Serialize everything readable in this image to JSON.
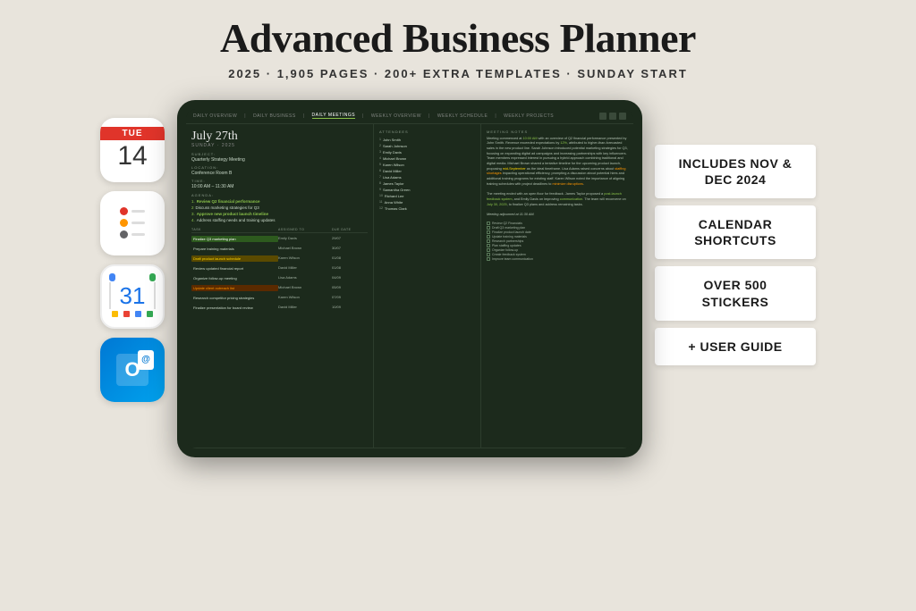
{
  "header": {
    "title": "Advanced Business Planner",
    "subtitle": "2025  ·  1,905 PAGES  ·  200+ EXTRA TEMPLATES  ·  SUNDAY START"
  },
  "badges": [
    {
      "id": "badge-nov-dec",
      "text": "INCLUDES NOV & DEC 2024"
    },
    {
      "id": "badge-calendar",
      "text": "CALENDAR SHORTCUTS"
    },
    {
      "id": "badge-stickers",
      "text": "OVER 500 STICKERS"
    },
    {
      "id": "badge-guide",
      "text": "+ USER GUIDE"
    }
  ],
  "planner": {
    "nav_items": [
      "DAILY OVERVIEW",
      "DAILY BUSINESS",
      "DAILY MEETINGS",
      "WEEKLY OVERVIEW",
      "WEEKLY SCHEDULE",
      "WEEKLY PROJECTS"
    ],
    "date": "July 27th",
    "date_sub": "SUNDAY · 2025",
    "subject_label": "SUBJECT:",
    "subject_value": "Quarterly Strategy Meeting",
    "location_label": "LOCATION:",
    "location_value": "Conference Room B",
    "time_label": "TIME:",
    "time_value": "10:00 AM – 11:30 AM",
    "agenda_label": "AGENDA:",
    "agenda_items": [
      {
        "num": "1.",
        "text": "Review Q2 financial performance",
        "highlight": true
      },
      {
        "num": "2",
        "text": "Discuss marketing strategies for Q3"
      },
      {
        "num": "3.",
        "text": "Approve new product launch timeline",
        "highlight": true
      },
      {
        "num": "4.",
        "text": "Address staffing needs and training updates"
      }
    ],
    "tasks_header": [
      "TASK",
      "ASSIGNED TO",
      "DUE DATE"
    ],
    "tasks": [
      {
        "name": "Finalize Q3 marketing plan",
        "person": "Emily Davis",
        "date": "29/07",
        "color": "green"
      },
      {
        "name": "Prepare training materials",
        "person": "Michael Brown",
        "date": "30/07",
        "color": "yellow"
      },
      {
        "name": "Draft product launch schedule",
        "person": "Karen Wilson",
        "date": "01/08",
        "color": "orange"
      },
      {
        "name": "Review updated financial report",
        "person": "David Miller",
        "date": "01/08",
        "color": ""
      },
      {
        "name": "Organize follow-up meeting",
        "person": "Lisa Adams",
        "date": "04/09",
        "color": ""
      },
      {
        "name": "Update client outreach list",
        "person": "Michael Brown",
        "date": "05/09",
        "color": "orange"
      },
      {
        "name": "Research competitor pricing strategies",
        "person": "Karen Wilson",
        "date": "07/09",
        "color": ""
      },
      {
        "name": "Finalize presentation for board review",
        "person": "David Miller",
        "date": "10/09",
        "color": ""
      }
    ],
    "attendees_label": "ATTENDEES",
    "attendees": [
      "John Smith",
      "Sarah Johnson",
      "Emily Davis",
      "Michael Brown",
      "Karen Wilson",
      "David Miller",
      "Lisa Adams",
      "James Taylor",
      "Samantha Green",
      "Richard Lee",
      "Anna White",
      "Thomas Clark"
    ],
    "notes_label": "MEETING NOTES",
    "notes": "Meeting commenced at 10:00 AM with an overview of Q2 financial performance presented by John Smith. Revenue exceeded expectations by 12%, attributed to higher-than-forecasted sales in the new product line. Sarah Johnson introduced potential marketing strategies for Q3, focusing on expanding digital ad campaigns and increasing partnerships with key influencers. Team members expressed interest in pursuing a hybrid approach combining traditional and digital media. Michael Brown shared a tentative timeline for the upcoming product launch, proposing mid-September as the ideal timeframe. Lisa Adams raised concerns about staffing shortages impacting operational efficiency, prompting a discussion about potential hires and additional training programs for existing staff. Karen Wilson noted the importance of aligning training schedules with project deadlines to minimize disruptions. The meeting ended with an open floor for feedback. James Taylor proposed a post-launch feedback system, and Emily Davis on improving communication. The team will reconvene on July 30, 2025, to finalize Q3 plans and address remaining tasks. Meeting adjourned at 11:30 AM.",
    "checklist_items": [
      "Review Q2 Financials",
      "Draft Q3 marketing plan",
      "Finalize product launch date",
      "Update training materials",
      "Research partnerships",
      "Plan staffing updates",
      "Organize follow-up",
      "Create feedback system",
      "Improve team communication"
    ]
  },
  "left_icons": [
    {
      "id": "calendar-icon",
      "type": "calendar",
      "day": "TUE",
      "num": "14"
    },
    {
      "id": "reminders-icon",
      "type": "reminders"
    },
    {
      "id": "google-calendar-icon",
      "type": "gcal",
      "num": "31"
    },
    {
      "id": "outlook-icon",
      "type": "outlook",
      "letter": "O"
    }
  ]
}
